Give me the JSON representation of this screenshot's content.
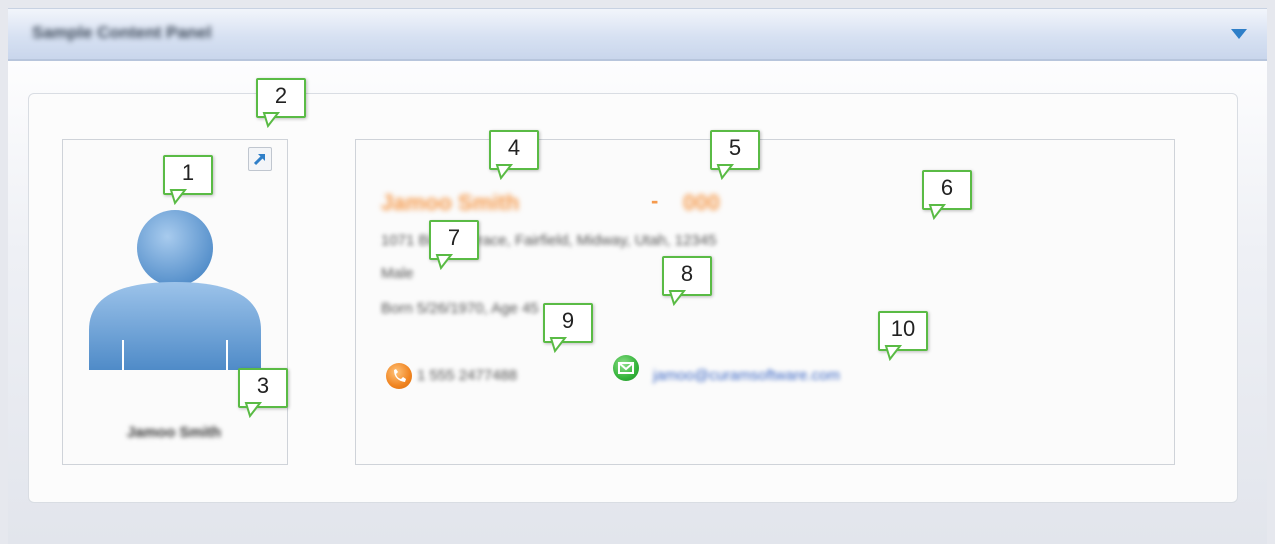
{
  "panel": {
    "title": "Sample Content Panel",
    "collapse_icon": "triangle-down-icon"
  },
  "contact": {
    "name_under_photo": "Jamoo Smith",
    "full_name": "Jamoo Smith",
    "separator": "-",
    "id": "000",
    "address": "1071 Birch Terrace, Fairfield, Midway, Utah, 12345",
    "gender": "Male",
    "born": "Born 5/26/1970, Age 45",
    "phone": "1 555 2477488",
    "email": "jamoo@curamsoftware.com",
    "phone_icon": "phone-icon",
    "email_icon": "email-icon",
    "launch_icon": "open-external-icon",
    "avatar_icon": "person-silhouette-icon"
  },
  "callouts": [
    "1",
    "2",
    "3",
    "4",
    "5",
    "6",
    "7",
    "8",
    "9",
    "10"
  ],
  "colors": {
    "header_blue": "#d7e1f2",
    "accent_orange": "#f59a4c",
    "link_blue": "#3a66c4",
    "callout_green": "#5abb45",
    "avatar_blue": "#6fa5d8"
  }
}
